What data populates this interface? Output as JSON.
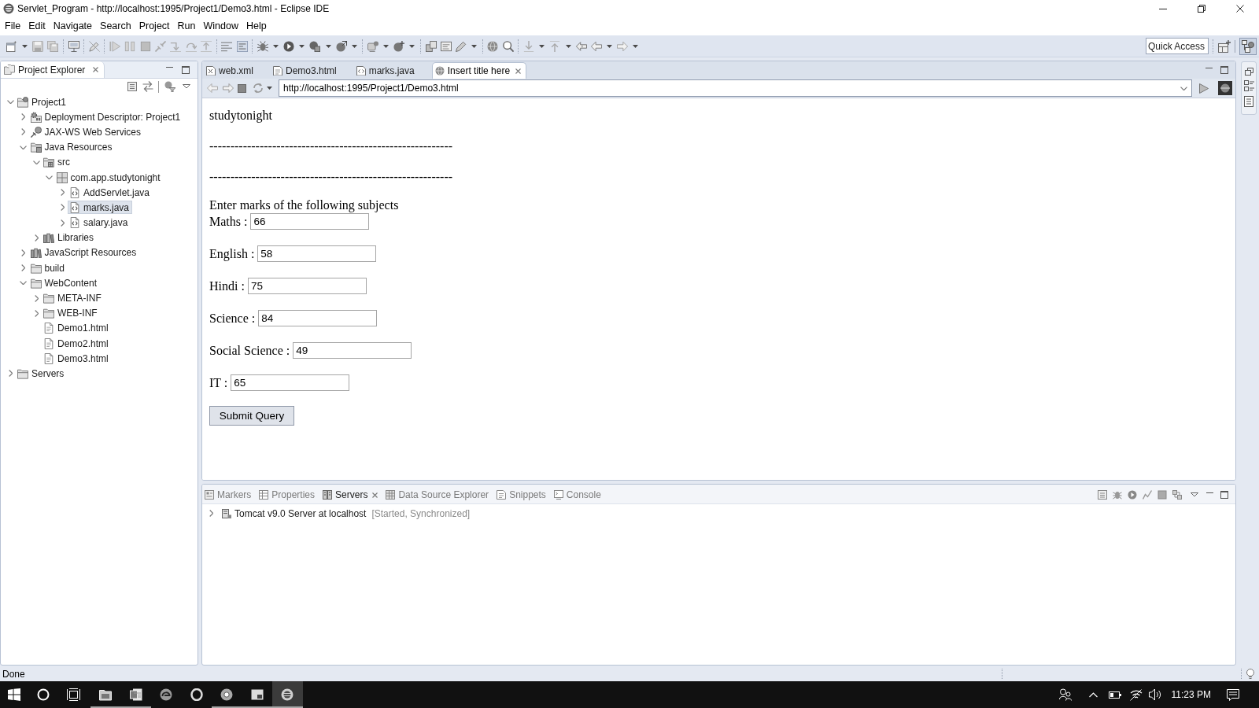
{
  "window": {
    "title": "Servlet_Program - http://localhost:1995/Project1/Demo3.html - Eclipse IDE"
  },
  "menu": [
    "File",
    "Edit",
    "Navigate",
    "Search",
    "Project",
    "Run",
    "Window",
    "Help"
  ],
  "quick_access": {
    "placeholder": "Quick Access"
  },
  "project_explorer": {
    "title": "Project Explorer",
    "tree": [
      {
        "label": "Project1",
        "kind": "project",
        "expanded": true,
        "selected": false,
        "children": [
          {
            "label": "Deployment Descriptor: Project1",
            "kind": "descriptor",
            "expanded": false,
            "selected": false
          },
          {
            "label": "JAX-WS Web Services",
            "kind": "web-services",
            "expanded": false,
            "selected": false
          },
          {
            "label": "Java Resources",
            "kind": "java-resources",
            "expanded": true,
            "selected": false,
            "children": [
              {
                "label": "src",
                "kind": "source-folder",
                "expanded": true,
                "selected": false,
                "children": [
                  {
                    "label": "com.app.studytonight",
                    "kind": "package",
                    "expanded": true,
                    "selected": false,
                    "children": [
                      {
                        "label": "AddServlet.java",
                        "kind": "java-file",
                        "expanded": false,
                        "selected": false
                      },
                      {
                        "label": "marks.java",
                        "kind": "java-file",
                        "expanded": false,
                        "selected": true
                      },
                      {
                        "label": "salary.java",
                        "kind": "java-file",
                        "expanded": false,
                        "selected": false
                      }
                    ]
                  }
                ]
              },
              {
                "label": "Libraries",
                "kind": "libraries",
                "expanded": false,
                "selected": false
              }
            ]
          },
          {
            "label": "JavaScript Resources",
            "kind": "libraries",
            "expanded": false,
            "selected": false
          },
          {
            "label": "build",
            "kind": "folder",
            "expanded": false,
            "selected": false
          },
          {
            "label": "WebContent",
            "kind": "folder",
            "expanded": true,
            "selected": false,
            "children": [
              {
                "label": "META-INF",
                "kind": "folder",
                "expanded": false,
                "selected": false
              },
              {
                "label": "WEB-INF",
                "kind": "folder",
                "expanded": false,
                "selected": false
              },
              {
                "label": "Demo1.html",
                "kind": "html-file",
                "selected": false
              },
              {
                "label": "Demo2.html",
                "kind": "html-file",
                "selected": false
              },
              {
                "label": "Demo3.html",
                "kind": "html-file",
                "selected": false
              }
            ]
          }
        ]
      },
      {
        "label": "Servers",
        "kind": "folder",
        "expanded": false,
        "selected": false
      }
    ]
  },
  "editor": {
    "tabs": [
      {
        "label": "web.xml",
        "kind": "xml",
        "selected": false
      },
      {
        "label": "Demo3.html",
        "kind": "html",
        "selected": false
      },
      {
        "label": "marks.java",
        "kind": "java",
        "selected": false
      },
      {
        "label": "Insert title here",
        "kind": "browser",
        "selected": true
      }
    ],
    "browser": {
      "url": "http://localhost:1995/Project1/Demo3.html",
      "page": {
        "heading": "studytonight",
        "rules": [
          "----------------------------------------------------------",
          "----------------------------------------------------------"
        ],
        "intro": "Enter marks of the following subjects",
        "fields": [
          {
            "label": "Maths :",
            "value": "66"
          },
          {
            "label": "English :",
            "value": "58"
          },
          {
            "label": "Hindi :",
            "value": "75"
          },
          {
            "label": "Science :",
            "value": "84"
          },
          {
            "label": "Social Science :",
            "value": "49"
          },
          {
            "label": "IT :",
            "value": "65"
          }
        ],
        "submit": "Submit Query"
      }
    }
  },
  "bottom_panel": {
    "tabs": [
      {
        "label": "Markers",
        "kind": "markers",
        "selected": false
      },
      {
        "label": "Properties",
        "kind": "properties",
        "selected": false
      },
      {
        "label": "Servers",
        "kind": "servers",
        "selected": true
      },
      {
        "label": "Data Source Explorer",
        "kind": "data-source",
        "selected": false
      },
      {
        "label": "Snippets",
        "kind": "snippets",
        "selected": false
      },
      {
        "label": "Console",
        "kind": "console",
        "selected": false
      }
    ],
    "servers": [
      {
        "name": "Tomcat v9.0 Server at localhost",
        "status": "[Started, Synchronized]",
        "expanded": false
      }
    ]
  },
  "status_bar": {
    "message": "Done"
  },
  "taskbar": {
    "apps": [
      {
        "kind": "folder",
        "running": true,
        "selected": false
      },
      {
        "kind": "document",
        "running": true,
        "selected": false
      },
      {
        "kind": "swirl",
        "running": false,
        "selected": false
      },
      {
        "kind": "ring",
        "running": false,
        "selected": false
      },
      {
        "kind": "target",
        "running": true,
        "selected": false
      },
      {
        "kind": "window",
        "running": true,
        "selected": false
      },
      {
        "kind": "sphere",
        "running": true,
        "selected": true
      }
    ],
    "clock": "11:23 PM"
  }
}
